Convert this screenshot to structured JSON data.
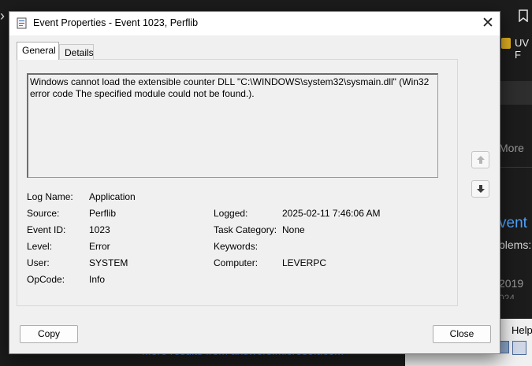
{
  "background": {
    "uv_label": "UV F",
    "more_label": "More",
    "event_heading": "vent",
    "problems_text": "blems:",
    "year_text": "2019",
    "year_text_2": "024",
    "more_results_link": "More results from answers.microsoft.com",
    "help_label": "Help"
  },
  "dialog": {
    "title": "Event Properties - Event 1023, Perflib",
    "close_glyph": "✕",
    "tabs": [
      {
        "label": "General",
        "selected": true
      },
      {
        "label": "Details",
        "selected": false
      }
    ],
    "description": "Windows cannot load the extensible counter DLL \"C:\\WINDOWS\\system32\\sysmain.dll\" (Win32 error code The specified module could not be found.).",
    "fields": {
      "log_name": {
        "label": "Log Name:",
        "value": "Application"
      },
      "source": {
        "label": "Source:",
        "value": "Perflib"
      },
      "event_id": {
        "label": "Event ID:",
        "value": "1023"
      },
      "level": {
        "label": "Level:",
        "value": "Error"
      },
      "user": {
        "label": "User:",
        "value": "SYSTEM"
      },
      "opcode": {
        "label": "OpCode:",
        "value": "Info"
      },
      "logged": {
        "label": "Logged:",
        "value": "2025-02-11 7:46:06 AM"
      },
      "task_category": {
        "label": "Task Category:",
        "value": "None"
      },
      "keywords": {
        "label": "Keywords:",
        "value": ""
      },
      "computer": {
        "label": "Computer:",
        "value": "LEVERPC"
      }
    },
    "buttons": {
      "copy": "Copy",
      "close": "Close"
    }
  },
  "colors": {
    "dialog_bg": "#f0f0f0",
    "titlebar_bg": "#ffffff",
    "page_bg": "#1c1c1c",
    "link_blue": "#4ea3ff"
  },
  "icons": [
    "chevron-right-icon",
    "bookmark-icon",
    "event-log-icon",
    "close-icon",
    "arrow-up-icon",
    "arrow-down-icon"
  ]
}
